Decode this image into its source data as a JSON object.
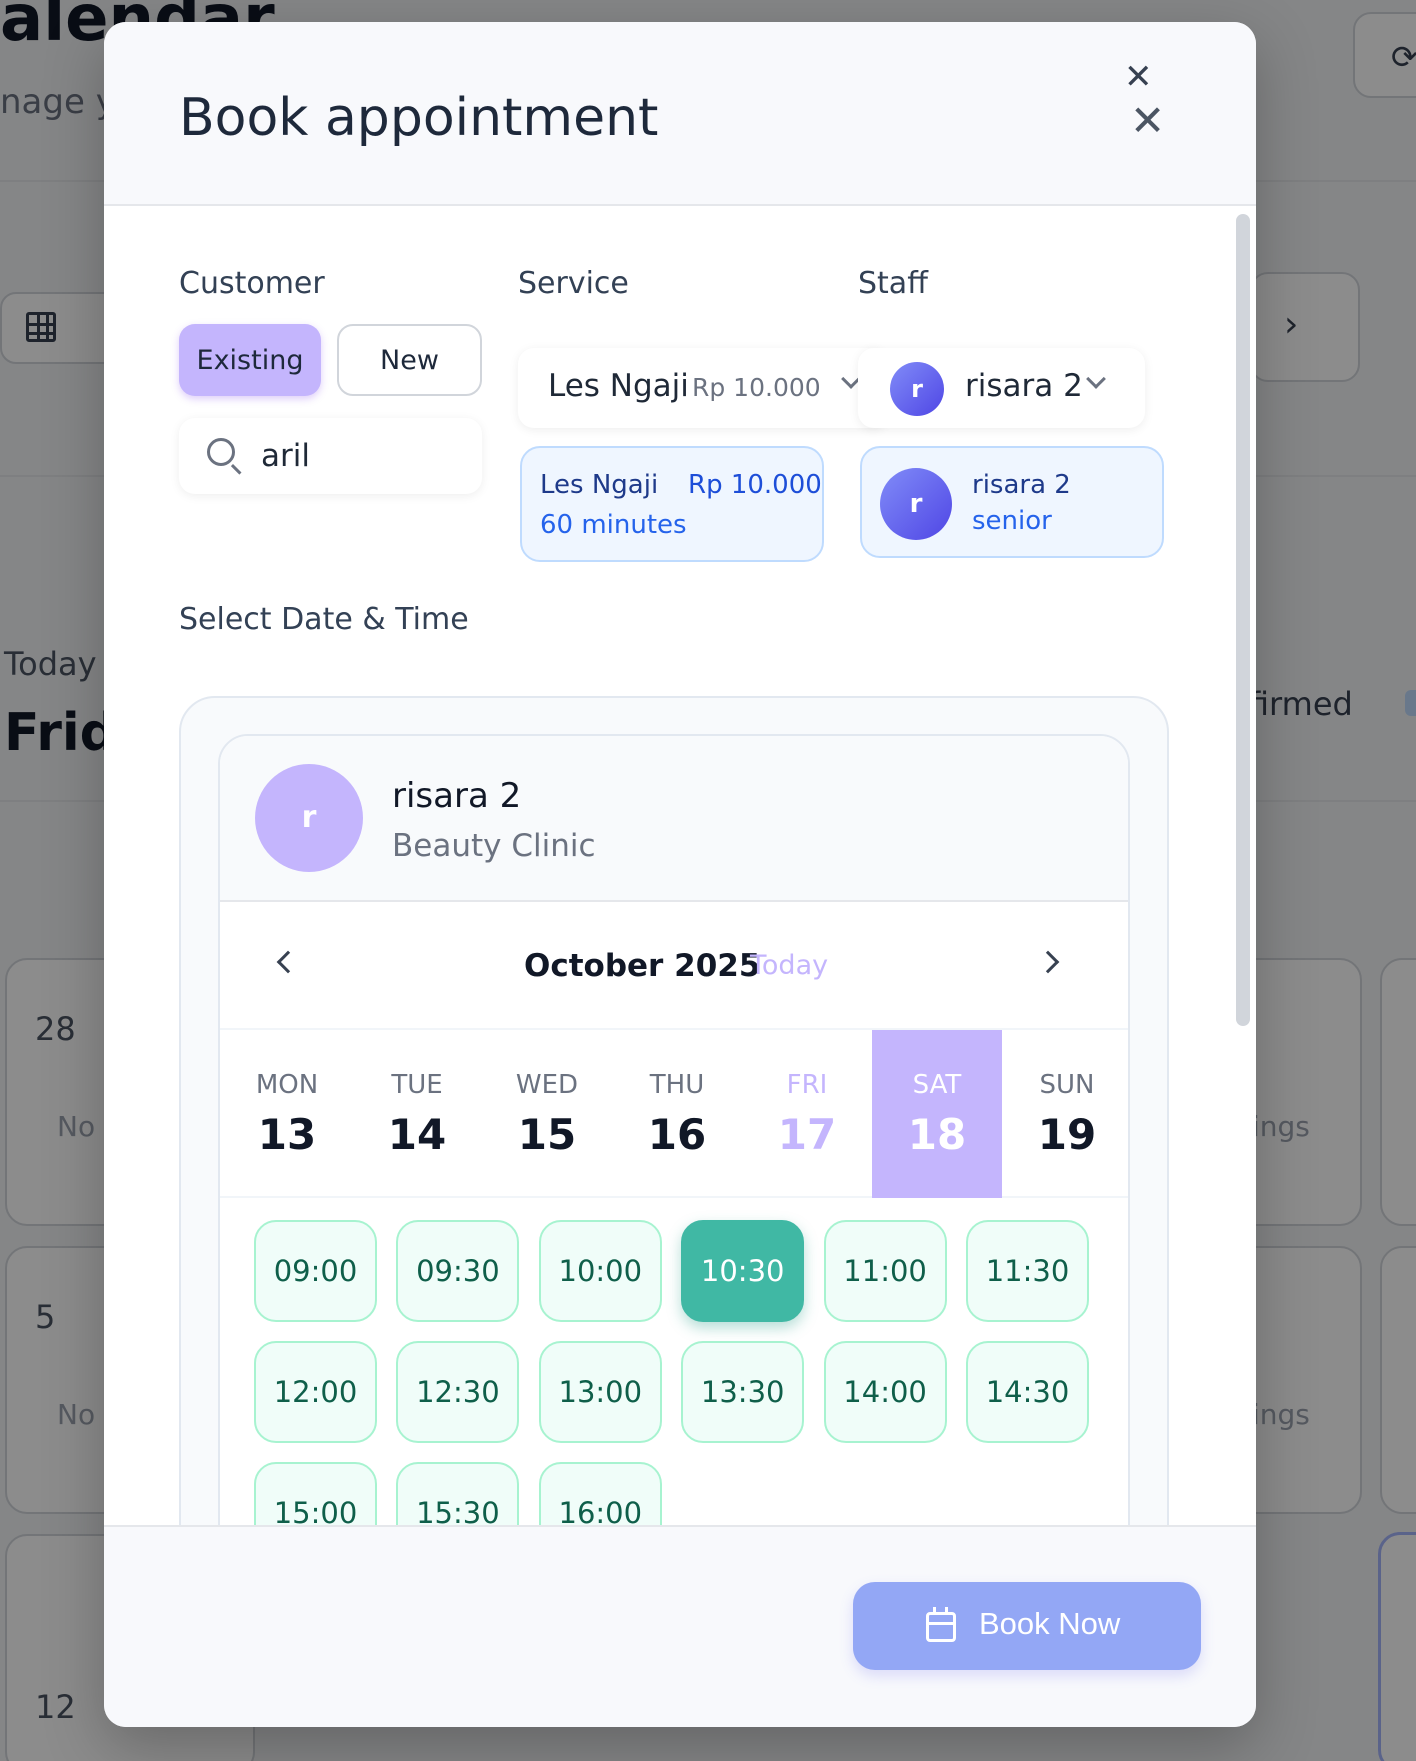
{
  "background": {
    "title": "alendar",
    "subtitle": "nage y",
    "today_label": "Today",
    "day_label": "Frid",
    "confirmed_label": "ifirmed",
    "cells": [
      {
        "num": "28",
        "note": "No l"
      },
      {
        "num": "5",
        "note": "No l"
      },
      {
        "num": "12",
        "note": ""
      }
    ],
    "right_notes": [
      "ings",
      "ings"
    ]
  },
  "modal": {
    "title": "Book appointment",
    "close_symbol": "✕"
  },
  "customer": {
    "label": "Customer",
    "existing_label": "Existing",
    "new_label": "New",
    "search_value": "aril",
    "search_icon": "search-icon"
  },
  "service": {
    "label": "Service",
    "selected_name": "Les Ngaji",
    "selected_price": "Rp 10.000",
    "card_name": "Les Ngaji",
    "card_price": "Rp 10.000",
    "card_duration": "60 minutes"
  },
  "staff": {
    "label": "Staff",
    "avatar_letter": "r",
    "selected_name": "risara 2",
    "card_name": "risara 2",
    "card_role": "senior"
  },
  "datetime": {
    "label": "Select Date & Time",
    "provider_avatar": "r",
    "provider_name": "risara 2",
    "provider_org": "Beauty Clinic",
    "month": "October 2025",
    "today_label": "Today",
    "days": [
      {
        "name": "MON",
        "date": "13"
      },
      {
        "name": "TUE",
        "date": "14"
      },
      {
        "name": "WED",
        "date": "15"
      },
      {
        "name": "THU",
        "date": "16"
      },
      {
        "name": "FRI",
        "date": "17"
      },
      {
        "name": "SAT",
        "date": "18"
      },
      {
        "name": "SUN",
        "date": "19"
      }
    ],
    "today_index": 4,
    "selected_index": 5,
    "slots": [
      "09:00",
      "09:30",
      "10:00",
      "10:30",
      "11:00",
      "11:30",
      "12:00",
      "12:30",
      "13:00",
      "13:30",
      "14:00",
      "14:30",
      "15:00",
      "15:30",
      "16:00"
    ],
    "selected_slot": "10:30"
  },
  "footer": {
    "book_label": "Book Now",
    "book_icon": "calendar-icon"
  },
  "colors": {
    "accent_purple": "#c4b5fd",
    "slot_active": "#40b8a4",
    "book_button": "#93a7f5"
  }
}
